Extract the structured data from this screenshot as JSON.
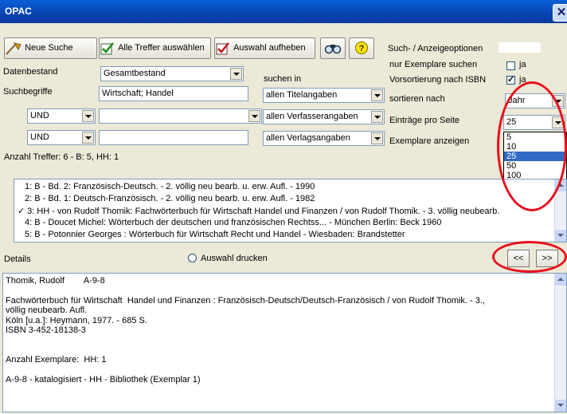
{
  "window": {
    "title": "OPAC",
    "close_label": "✕"
  },
  "toolbar": {
    "new_search": "Neue Suche",
    "select_all": "Alle Treffer auswählen",
    "clear_selection": "Auswahl aufheben",
    "options_title": "Such- / Anzeigeoptionen"
  },
  "form": {
    "collection_label": "Datenbestand",
    "collection_value": "Gesamtbestand",
    "search_terms_label": "Suchbegriffe",
    "search_terms_value": "Wirtschaft; Handel",
    "search_in_label": "suchen in",
    "search_in_values": [
      "allen Titelangaben",
      "allen Verfasserangaben",
      "allen Verlagsangaben"
    ],
    "operator_1": "UND",
    "operator_2": "UND",
    "term_2": "",
    "term_3": "",
    "hits_summary": "Anzahl Treffer: 6 - B: 5, HH: 1"
  },
  "options": {
    "only_copies_label": "nur Exemplare suchen",
    "only_copies_checked": false,
    "only_copies_value": "ja",
    "presort_isbn_label": "Vorsortierung nach ISBN",
    "presort_isbn_checked": true,
    "presort_isbn_value": "ja",
    "sort_by_label": "sortieren nach",
    "sort_by_value": "Jahr",
    "per_page_label": "Einträge pro Seite",
    "per_page_value": "25",
    "show_copies_label": "Exemplare anzeigen",
    "per_page_options": [
      "5",
      "10",
      "25",
      "50",
      "100"
    ],
    "per_page_selected_index": 2
  },
  "results": [
    {
      "text": "1: B - Bd. 2: Französisch-Deutsch. - 2. völlig neu bearb. u. erw. Aufl. - 1990",
      "checked": false
    },
    {
      "text": "2: B - Bd. 1: Deutsch-Französisch. - 2. völlig neu bearb. u. erw. Aufl. - 1982",
      "checked": false
    },
    {
      "text": "3: HH - von Rudolf Thomik: Fachwörterbuch für Wirtschaft  Handel und Finanzen / von Rudolf Thomik. - 3. völlig neubearb.",
      "checked": true
    },
    {
      "text": "4: B - Doucet Michel: Wörterbuch der deutschen und französischen Rechtss... - München Berlin: Beck 1960",
      "checked": false
    },
    {
      "text": "5: B - Potonnier Georges : Wörterbuch für Wirtschaft Recht und Handel - Wiesbaden: Brandstetter",
      "checked": false
    }
  ],
  "check_mark": "✓",
  "details": {
    "label": "Details",
    "print_selection": "Auswahl drucken",
    "prev": "<<",
    "next": ">>",
    "lines": [
      "Thomik, Rudolf        A-9-8",
      "",
      "Fachwörterbuch für Wirtschaft  Handel und Finanzen : Französisch-Deutsch/Deutsch-Französisch / von Rudolf Thomik. - 3.,",
      "völlig neubearb. Aufl.",
      "Köln [u.a.]: Heymann, 1977. - 685 S.",
      "ISBN 3-452-18138-3",
      "",
      "",
      "Anzahl Exemplare:  HH: 1",
      "",
      "A-9-8 - katalogisiert - HH - Bibliothek (Exemplar 1)"
    ]
  }
}
